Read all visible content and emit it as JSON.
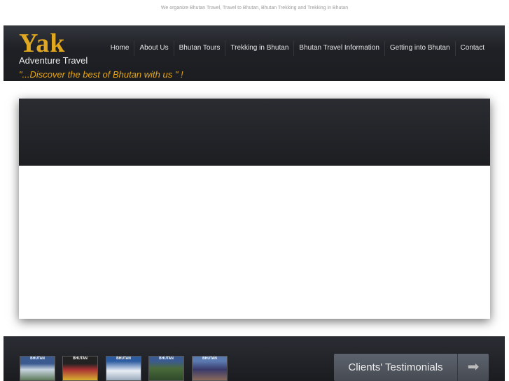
{
  "tagline": "We organize Bhutan Travel, Travel to Bhutan, Bhutan Trekking and Trekking in Bhutan",
  "logo": {
    "name": "Yak",
    "subtitle": "Adventure Travel"
  },
  "slogan": "\"...Discover the best of Bhutan with us  \" !",
  "nav": [
    "Home",
    "About Us",
    "Bhutan Tours",
    "Trekking in Bhutan",
    "Bhutan Travel Information",
    "Getting into Bhutan",
    "Contact"
  ],
  "thumbnails": [
    "BHUTAN",
    "BHUTAN",
    "BHUTAN",
    "BHUTAN",
    "BHUTAN"
  ],
  "testimonials": {
    "label": "Clients' Testimonials",
    "icon": "arrow-right-icon"
  },
  "colors": {
    "accent": "#e8a615",
    "header_bg": "#1f2126"
  }
}
